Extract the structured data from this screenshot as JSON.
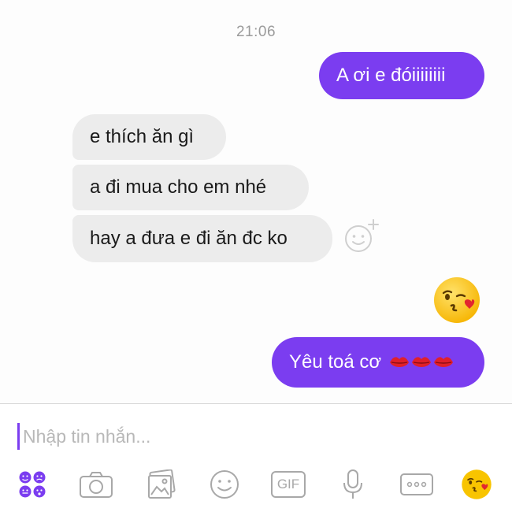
{
  "conversation": {
    "timestamp": "21:06",
    "messages": [
      {
        "direction": "out",
        "text": "A ơi e đóiiiiiiii"
      },
      {
        "direction": "in",
        "text": "e thích ăn gì"
      },
      {
        "direction": "in",
        "text": "a đi mua cho em nhé"
      },
      {
        "direction": "in",
        "text": "hay a đưa e đi ăn đc ko"
      },
      {
        "direction": "out",
        "emoji": "kissing-face-with-heart"
      },
      {
        "direction": "out",
        "text": "Yêu toá cơ",
        "trailing_emoji": [
          "kiss-lips",
          "kiss-lips",
          "kiss-lips"
        ]
      }
    ]
  },
  "composer": {
    "placeholder": "Nhập tin nhắn...",
    "gif_label": "GIF",
    "tools": [
      "apps-icon",
      "camera-icon",
      "gallery-icon",
      "emoji-icon",
      "gif-icon",
      "microphone-icon",
      "more-icon",
      "quick-emoji-icon"
    ]
  },
  "colors": {
    "accent": "#7b3df0",
    "incoming_bubble": "#ececec",
    "timestamp_text": "#9b9b9b",
    "placeholder_text": "#b8b8b8"
  }
}
